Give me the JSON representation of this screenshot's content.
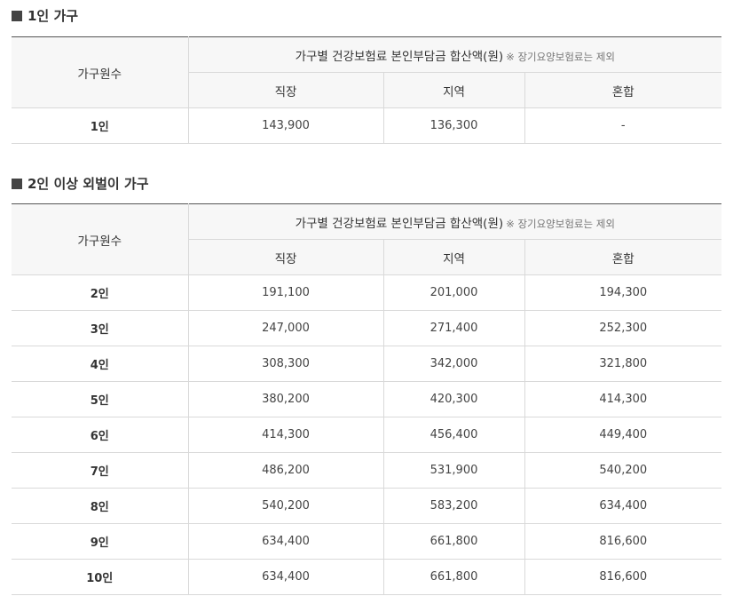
{
  "section1": {
    "title": "1인 가구",
    "header": {
      "row_header": "가구원수",
      "group_label": "가구별 건강보험료 본인부담금 합산액(원)",
      "group_note": "※ 장기요양보험료는 제외",
      "columns": [
        "직장",
        "지역",
        "혼합"
      ]
    },
    "rows": [
      {
        "label": "1인",
        "values": [
          "143,900",
          "136,300",
          "-"
        ]
      }
    ]
  },
  "section2": {
    "title": "2인 이상 외벌이 가구",
    "header": {
      "row_header": "가구원수",
      "group_label": "가구별 건강보험료 본인부담금 합산액(원)",
      "group_note": "※ 장기요양보험료는 제외",
      "columns": [
        "직장",
        "지역",
        "혼합"
      ]
    },
    "rows": [
      {
        "label": "2인",
        "values": [
          "191,100",
          "201,000",
          "194,300"
        ]
      },
      {
        "label": "3인",
        "values": [
          "247,000",
          "271,400",
          "252,300"
        ]
      },
      {
        "label": "4인",
        "values": [
          "308,300",
          "342,000",
          "321,800"
        ]
      },
      {
        "label": "5인",
        "values": [
          "380,200",
          "420,300",
          "414,300"
        ]
      },
      {
        "label": "6인",
        "values": [
          "414,300",
          "456,400",
          "449,400"
        ]
      },
      {
        "label": "7인",
        "values": [
          "486,200",
          "531,900",
          "540,200"
        ]
      },
      {
        "label": "8인",
        "values": [
          "540,200",
          "583,200",
          "634,400"
        ]
      },
      {
        "label": "9인",
        "values": [
          "634,400",
          "661,800",
          "816,600"
        ]
      },
      {
        "label": "10인",
        "values": [
          "634,400",
          "661,800",
          "816,600"
        ]
      }
    ]
  }
}
